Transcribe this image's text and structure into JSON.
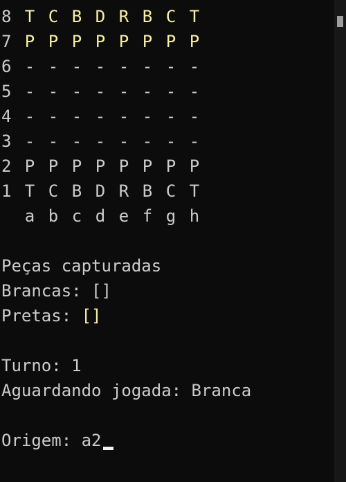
{
  "board": {
    "ranks": [
      {
        "label": "8",
        "cells": [
          "T",
          "C",
          "B",
          "D",
          "R",
          "B",
          "C",
          "T"
        ],
        "kind": "black"
      },
      {
        "label": "7",
        "cells": [
          "P",
          "P",
          "P",
          "P",
          "P",
          "P",
          "P",
          "P"
        ],
        "kind": "black"
      },
      {
        "label": "6",
        "cells": [
          "-",
          "-",
          "-",
          "-",
          "-",
          "-",
          "-",
          "-"
        ],
        "kind": "empty"
      },
      {
        "label": "5",
        "cells": [
          "-",
          "-",
          "-",
          "-",
          "-",
          "-",
          "-",
          "-"
        ],
        "kind": "empty"
      },
      {
        "label": "4",
        "cells": [
          "-",
          "-",
          "-",
          "-",
          "-",
          "-",
          "-",
          "-"
        ],
        "kind": "empty"
      },
      {
        "label": "3",
        "cells": [
          "-",
          "-",
          "-",
          "-",
          "-",
          "-",
          "-",
          "-"
        ],
        "kind": "empty"
      },
      {
        "label": "2",
        "cells": [
          "P",
          "P",
          "P",
          "P",
          "P",
          "P",
          "P",
          "P"
        ],
        "kind": "white"
      },
      {
        "label": "1",
        "cells": [
          "T",
          "C",
          "B",
          "D",
          "R",
          "B",
          "C",
          "T"
        ],
        "kind": "white"
      }
    ],
    "files": [
      "a",
      "b",
      "c",
      "d",
      "e",
      "f",
      "g",
      "h"
    ]
  },
  "captured": {
    "heading": "Peças capturadas",
    "white_label": "Brancas: ",
    "white_list": "[]",
    "black_label": "Pretas: ",
    "black_list": "[]"
  },
  "status": {
    "turn_text": "Turno: 1",
    "waiting_text": "Aguardando jogada: Branca"
  },
  "prompt": {
    "label": "Origem: ",
    "value": "a2"
  },
  "colors": {
    "background": "#0c0c0c",
    "foreground": "#cccccc",
    "black_pieces": "#f9f1a5"
  }
}
